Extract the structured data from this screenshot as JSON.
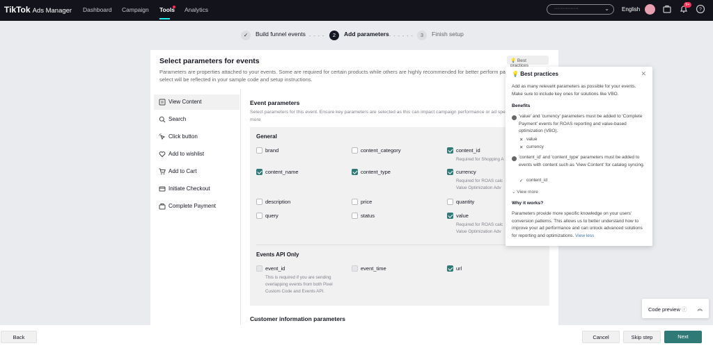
{
  "topbar": {
    "logo": "TikTok",
    "logo_sub": "Ads Manager",
    "nav": [
      "Dashboard",
      "Campaign",
      "Tools",
      "Analytics"
    ],
    "account_value": "···············",
    "language": "English",
    "notification_count": "9+"
  },
  "stepper": {
    "step1_label": "Build funnel events",
    "step2_num": "2",
    "step2_label": "Add parameters",
    "step3_num": "3",
    "step3_label": "Finish setup",
    "dash": "- - - -",
    "dash2": "- - - - - -"
  },
  "card": {
    "title": "Select parameters for events",
    "desc": "Parameters are properties attached to your events. Some are required for certain products while others are highly recommended for better perform parameters you select will be reflected in your sample code and setup instructions.",
    "best_practices_btn": "Best practices"
  },
  "events": [
    "View Content",
    "Search",
    "Click button",
    "Add to wishlist",
    "Add to Cart",
    "Initiate Checkout",
    "Complete Payment"
  ],
  "event_params": {
    "title": "Event parameters",
    "desc": "Select parameters for this event. Ensure key parameters are selected as this can impact campaign performance or ad spend more",
    "general_title": "General",
    "events_api_title": "Events API Only",
    "customer_info_title": "Customer information parameters",
    "params": {
      "brand": "brand",
      "content_category": "content_category",
      "content_id": "content_id",
      "content_id_note": "Required for Shopping A",
      "content_name": "content_name",
      "content_type": "content_type",
      "currency": "currency",
      "currency_note_1": "Required for ROAS calc",
      "currency_note_2": "Value Optimization Adv",
      "description": "description",
      "price": "price",
      "quantity": "quantity",
      "query": "query",
      "status": "status",
      "value": "value",
      "value_note_1": "Required for ROAS calc",
      "value_note_2": "Value Optimization Adv",
      "event_id": "event_id",
      "event_id_note": "This is required if you are sending overlapping events from both Pixel Custom Code and Events API.",
      "event_time": "event_time",
      "url": "url"
    }
  },
  "popup": {
    "title": "Best practices",
    "intro": "Add as many relevant parameters as possible for your events. Make sure to include key ones for solutions like VBO.",
    "benefits_title": "Benefits",
    "b1": "'value' and 'currency' parameters must be added to 'Complete Payment' events for ROAS reporting and value-based optimization (VBO).",
    "b1_items": [
      "value",
      "currency"
    ],
    "b2": "'content_id' and 'content_type' parameters must be added to events with content such as 'View Content' for catalog syncing.",
    "b2_items": [
      "content_id"
    ],
    "view_more": "View more",
    "why_title": "Why it works?",
    "why_text": "Parameters provide more specific knowledge on your users' conversion patterns. This allows us to better understand how to improve your ad performance and can unlock advanced solutions for reporting and optimizations.",
    "view_less": "View less"
  },
  "code_preview": "Code preview",
  "bottom": {
    "back": "Back",
    "cancel": "Cancel",
    "skip": "Skip step",
    "next": "Next"
  },
  "colors": {
    "accent": "#2f7a77",
    "brand_cyan": "#25f4ee",
    "brand_red": "#fe2c55",
    "topbar": "#12131b"
  }
}
